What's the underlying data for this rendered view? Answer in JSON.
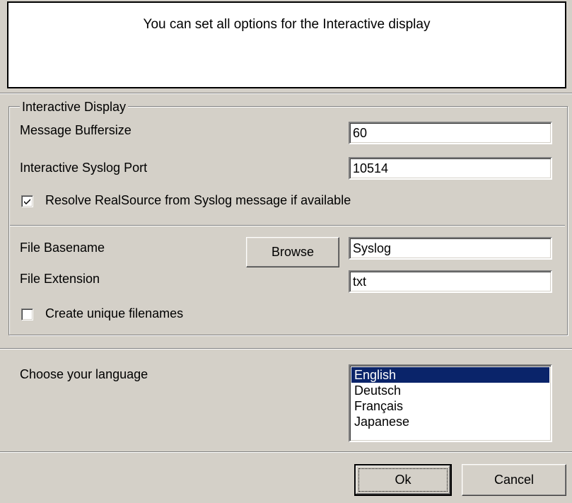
{
  "description": {
    "text": "You can set all options for the Interactive display"
  },
  "interactive_display": {
    "legend": "Interactive Display",
    "buffersize_label": "Message Buffersize",
    "buffersize_value": "60",
    "port_label": "Interactive Syslog Port",
    "port_value": "10514",
    "resolve_label": "Resolve RealSource from Syslog message if available",
    "resolve_checked": true
  },
  "file": {
    "basename_label": "File Basename",
    "browse_label": "Browse",
    "basename_value": "Syslog",
    "extension_label": "File Extension",
    "extension_value": "txt",
    "unique_label": "Create unique filenames",
    "unique_checked": false
  },
  "language": {
    "label": "Choose your language",
    "options": [
      "English",
      "Deutsch",
      "Français",
      "Japanese"
    ],
    "selected": "English"
  },
  "buttons": {
    "ok_label": "Ok",
    "cancel_label": "Cancel"
  },
  "colors": {
    "dialog_bg": "#d4d0c8",
    "selection_bg": "#0a246a",
    "selection_fg": "#ffffff"
  },
  "icons": {
    "checkmark": "check-mark-icon"
  }
}
